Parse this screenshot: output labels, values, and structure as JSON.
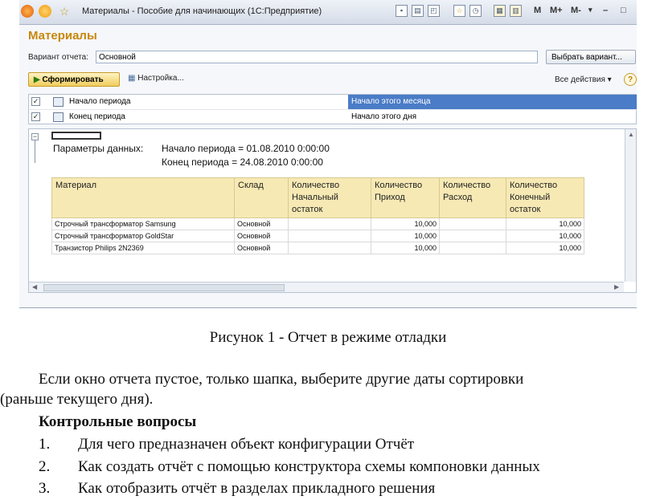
{
  "window": {
    "title": "Материалы - Пособие для начинающих (1С:Предприятие)",
    "toolbar_texts": [
      "M",
      "M+",
      "M-"
    ],
    "minimize": "–",
    "close": "□"
  },
  "form": {
    "header": "Материалы",
    "variant_label": "Вариант отчета:",
    "variant_value": "Основной",
    "choose_variant_button": "Выбрать вариант...",
    "generate_button": "Сформировать",
    "settings_button": "Настройка...",
    "all_actions": "Все действия",
    "help": "?"
  },
  "params": [
    {
      "checked": true,
      "name": "Начало периода",
      "value": "Начало этого месяца"
    },
    {
      "checked": true,
      "name": "Конец периода",
      "value": "Начало этого дня"
    }
  ],
  "report": {
    "params_label": "Параметры данных:",
    "param_line1": "Начало периода = 01.08.2010 0:00:00",
    "param_line2": "Конец периода = 24.08.2010 0:00:00",
    "columns": [
      "Материал",
      "Склад",
      "Количество Начальный остаток",
      "Количество Приход",
      "Количество Расход",
      "Количество Конечный остаток"
    ],
    "rows": [
      [
        "Строчный трансформатор Samsung",
        "Основной",
        "",
        "10,000",
        "",
        "10,000"
      ],
      [
        "Строчный трансформатор GoldStar",
        "Основной",
        "",
        "10,000",
        "",
        "10,000"
      ],
      [
        "Транзистор Philips 2N2369",
        "Основной",
        "",
        "10,000",
        "",
        "10,000"
      ]
    ]
  },
  "document": {
    "caption": "Рисунок 1 - Отчет в режиме отладки",
    "para_line1": "Если окно отчета пустое, только шапка, выберите другие даты сортировки",
    "para_line2": "(раньше текущего дня).",
    "questions_title": "Контрольные вопросы",
    "questions": [
      {
        "num": "1.",
        "text": "Для чего предназначен объект конфигурации Отчёт"
      },
      {
        "num": "2.",
        "text": "Как создать отчёт с помощью конструктора схемы компоновки данных"
      },
      {
        "num": "3.",
        "text": "Как отобразить отчёт в разделах прикладного решения"
      }
    ]
  }
}
